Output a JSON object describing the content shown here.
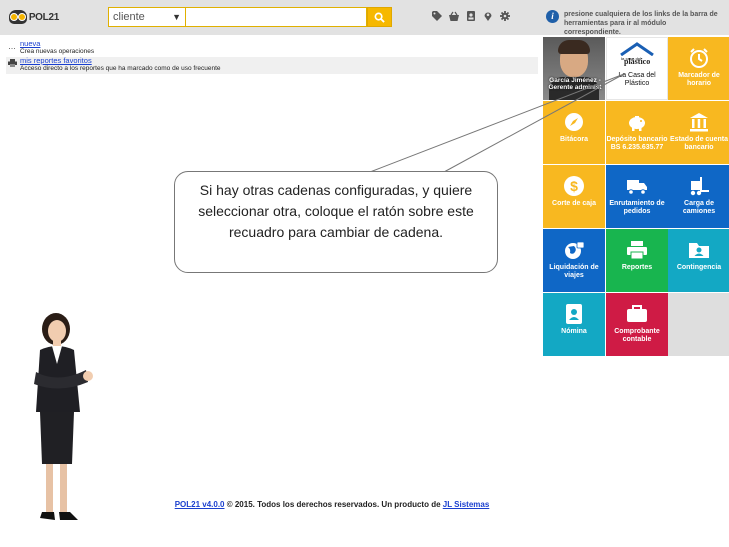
{
  "header": {
    "logo_text": "POL21",
    "select_value": "cliente",
    "search_value": "",
    "hint": "presione cualquiera de los links de la barra de herramientas para ir al módulo correspondiente."
  },
  "list": [
    {
      "link": "nueva",
      "desc": "Crea nuevas operaciones"
    },
    {
      "link": "mis reportes favoritos",
      "desc": "Acceso directo a los reportes que ha marcado como de uso frecuente"
    }
  ],
  "tiles": {
    "user_caption": "García Jiménez - Gerente administ",
    "brand_small": "la casa del",
    "brand_big": "plástico",
    "brand_caption": "La Casa del Plástico",
    "marcador": "Marcador de horario",
    "bitacora": "Bitácora",
    "deposito": "Depósito bancario",
    "deposito_amount": "BS 6.235.635.77",
    "estado": "Estado de cuenta bancario",
    "corte": "Corte de caja",
    "enrutamiento": "Enrutamiento de pedidos",
    "carga": "Carga de camiones",
    "liquidacion": "Liquidación de viajes",
    "reportes": "Reportes",
    "contingencia": "Contingencia",
    "nomina": "Nómina",
    "comprobante": "Comprobante contable"
  },
  "callout": "Si hay otras cadenas configuradas,  y quiere seleccionar otra, coloque el ratón sobre este recuadro para cambiar de cadena.",
  "footer": {
    "version_link": "POL21 v4.0.0",
    "text": " © 2015. Todos los derechos reservados. Un producto de ",
    "company_link": "JL Sistemas"
  },
  "colors": {
    "yellow": "#f8b820",
    "blue": "#0f67c6",
    "green": "#18b54f",
    "teal": "#13a8c4",
    "crimson": "#cf1b45"
  }
}
